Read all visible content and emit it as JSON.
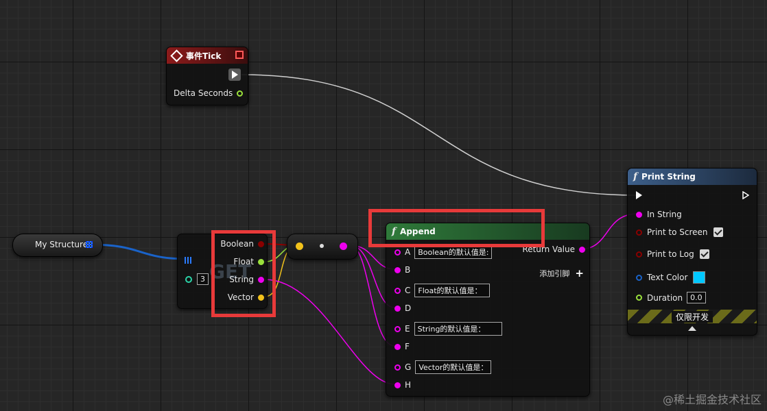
{
  "event_node": {
    "title": "事件Tick",
    "pins": [
      {
        "label": "Delta Seconds"
      }
    ]
  },
  "variable_node": {
    "label": "My Structure"
  },
  "get_node": {
    "watermark": "GET",
    "index_value": "3",
    "pins": [
      {
        "label": "Boolean"
      },
      {
        "label": "Float"
      },
      {
        "label": "String"
      },
      {
        "label": "Vector"
      }
    ]
  },
  "append_node": {
    "title": "Append",
    "return_label": "Return Value",
    "add_pin_label": "添加引脚",
    "inputs": [
      {
        "label": "A",
        "value": "Boolean的默认值是:"
      },
      {
        "label": "B",
        "value": ""
      },
      {
        "label": "C",
        "value": "Float的默认值是："
      },
      {
        "label": "D",
        "value": ""
      },
      {
        "label": "E",
        "value": "String的默认值是："
      },
      {
        "label": "F",
        "value": ""
      },
      {
        "label": "G",
        "value": "Vector的默认值是："
      },
      {
        "label": "H",
        "value": ""
      }
    ]
  },
  "print_node": {
    "title": "Print String",
    "in_string": "In String",
    "print_to_screen": "Print to Screen",
    "print_to_log": "Print to Log",
    "text_color": "Text Color",
    "duration": "Duration",
    "duration_value": "0.0",
    "dev_only": "仅限开发"
  },
  "watermark": "@稀土掘金技术社区",
  "colors": {
    "boolean": "#8a0000",
    "float": "#9ae03c",
    "string": "#ee00ee",
    "vector": "#f2c21b",
    "struct": "#1a63c9",
    "exec": "#ffffff",
    "text_color_swatch": "#00c8ff",
    "highlight": "#e83a3a"
  }
}
